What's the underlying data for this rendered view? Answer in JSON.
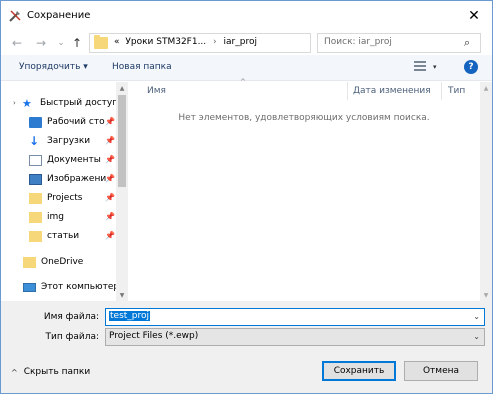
{
  "window": {
    "title": "Сохранение",
    "close_glyph": "✕"
  },
  "nav": {
    "back_glyph": "←",
    "forward_glyph": "→",
    "recent_glyph": "⌄",
    "up_glyph": "↑",
    "breadcrumb": {
      "prefix": "«",
      "parent": "Уроки STM32F1...",
      "separator": "›",
      "current": "iar_proj"
    },
    "address_dropdown_glyph": "⌄",
    "refresh_glyph": "↻",
    "search_placeholder": "Поиск: iar_proj",
    "search_glyph": "⌕"
  },
  "toolbar": {
    "organize_label": "Упорядочить ▾",
    "new_folder_label": "Новая папка",
    "view_dropdown_glyph": "▾",
    "help_glyph": "?"
  },
  "sidebar": {
    "quick_access": {
      "chevron": "›",
      "label": "Быстрый доступ"
    },
    "items": [
      {
        "label": "Рабочий сто",
        "icon": "desktop-icon",
        "pinned": true
      },
      {
        "label": "Загрузки",
        "icon": "downloads-icon",
        "pinned": true
      },
      {
        "label": "Документы",
        "icon": "documents-icon",
        "pinned": true
      },
      {
        "label": "Изображени",
        "icon": "pictures-icon",
        "pinned": true
      },
      {
        "label": "Projects",
        "icon": "folder-icon",
        "pinned": true
      },
      {
        "label": "img",
        "icon": "folder-icon",
        "pinned": true
      },
      {
        "label": "статьи",
        "icon": "folder-icon",
        "pinned": true
      }
    ],
    "onedrive_label": "OneDrive",
    "this_pc_label": "Этот компьютер",
    "pin_glyph": "📌",
    "scroll_up": "▲",
    "scroll_down": "▼"
  },
  "filelist": {
    "columns": [
      "Имя",
      "Дата изменения",
      "Тип"
    ],
    "sort_glyph": "^",
    "empty_message": "Нет элементов, удовлетворяющих условиям поиска.",
    "scroll_up": "▲",
    "scroll_down": "▼"
  },
  "form": {
    "filename_label": "Имя файла:",
    "filename_value": "test_proj",
    "filetype_label": "Тип файла:",
    "filetype_value": "Project Files (*.ewp)",
    "dropdown_glyph": "⌄"
  },
  "footer": {
    "hide_folders_glyph": "^",
    "hide_folders_label": "Скрыть папки",
    "save_label": "Сохранить",
    "cancel_label": "Отмена"
  },
  "colors": {
    "accent": "#0078d7",
    "help": "#1565c0",
    "folder": "#f6d77a"
  }
}
